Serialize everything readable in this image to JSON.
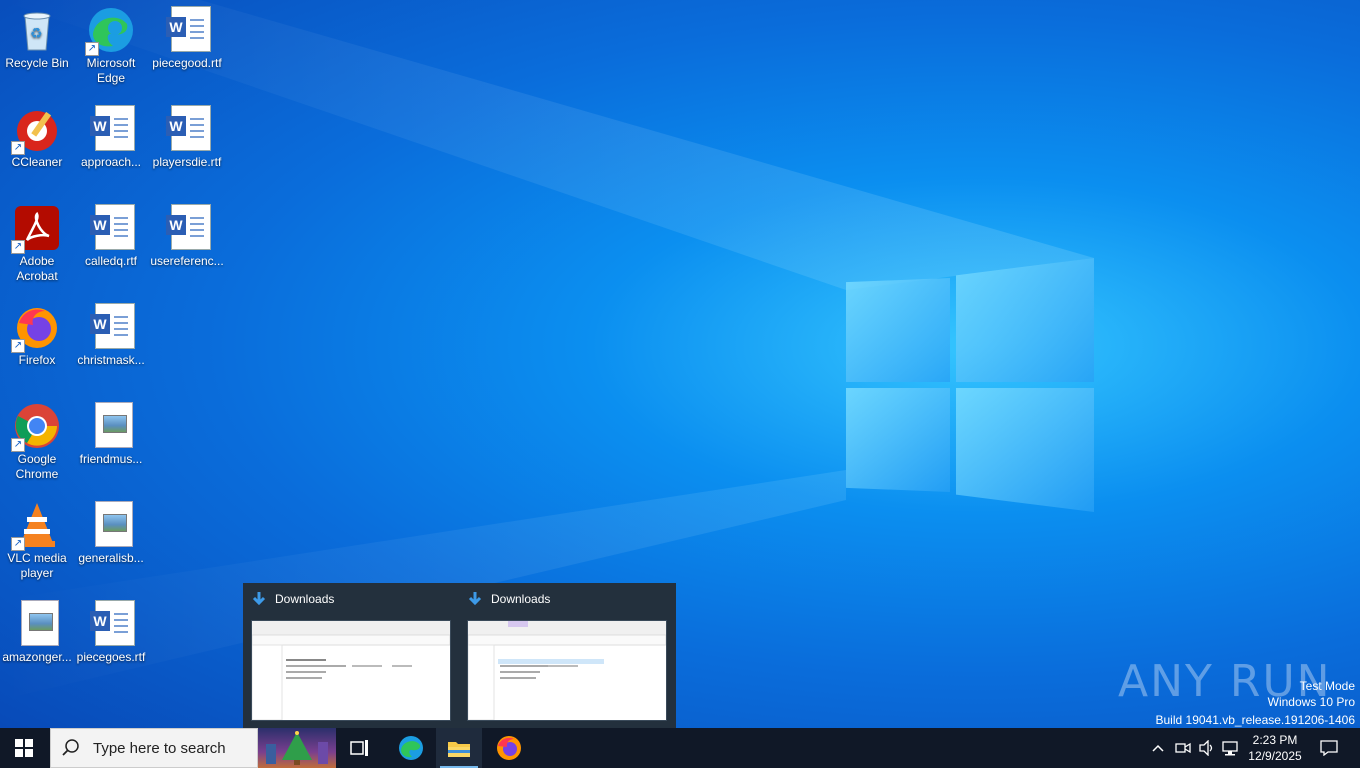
{
  "desktop": {
    "icons": [
      {
        "label": "Recycle Bin",
        "icon": "recycle-bin-icon"
      },
      {
        "label": "Microsoft Edge",
        "icon": "edge-icon"
      },
      {
        "label": "piecegood.rtf",
        "icon": "word-doc-icon"
      },
      {
        "label": "CCleaner",
        "icon": "ccleaner-icon"
      },
      {
        "label": "approach...",
        "icon": "word-doc-icon"
      },
      {
        "label": "playersdie.rtf",
        "icon": "word-doc-icon"
      },
      {
        "label": "Adobe Acrobat",
        "icon": "acrobat-icon"
      },
      {
        "label": "calledq.rtf",
        "icon": "word-doc-icon"
      },
      {
        "label": "usereferenc...",
        "icon": "word-doc-icon"
      },
      {
        "label": "Firefox",
        "icon": "firefox-icon"
      },
      {
        "label": "christmask...",
        "icon": "word-doc-icon"
      },
      {
        "label": "Google Chrome",
        "icon": "chrome-icon"
      },
      {
        "label": "friendmus...",
        "icon": "image-file-icon"
      },
      {
        "label": "VLC media player",
        "icon": "vlc-icon"
      },
      {
        "label": "generalisb...",
        "icon": "image-file-icon"
      },
      {
        "label": "amazonger...",
        "icon": "image-file-icon"
      },
      {
        "label": "piecegoes.rtf",
        "icon": "word-doc-icon"
      }
    ]
  },
  "flyout": {
    "windows": [
      {
        "title": "Downloads",
        "icon": "download-arrow-icon"
      },
      {
        "title": "Downloads",
        "icon": "download-arrow-icon"
      }
    ]
  },
  "watermark": {
    "brand": "ANY RUN",
    "line1": "Test Mode",
    "line2": "Windows 10 Pro",
    "line3": "Build 19041.vb_release.191206-1406"
  },
  "taskbar": {
    "search_placeholder": "Type here to search",
    "time": "2:23 PM",
    "date": "12/9/2025",
    "pinned": [
      "start-icon",
      "task-view-icon",
      "edge-icon",
      "file-explorer-icon",
      "firefox-icon"
    ]
  },
  "colors": {
    "taskbar_bg": "#101827",
    "flyout_bg": "#23303d",
    "active_indicator": "#76b9ed",
    "word_blue": "#2b5eb4"
  }
}
